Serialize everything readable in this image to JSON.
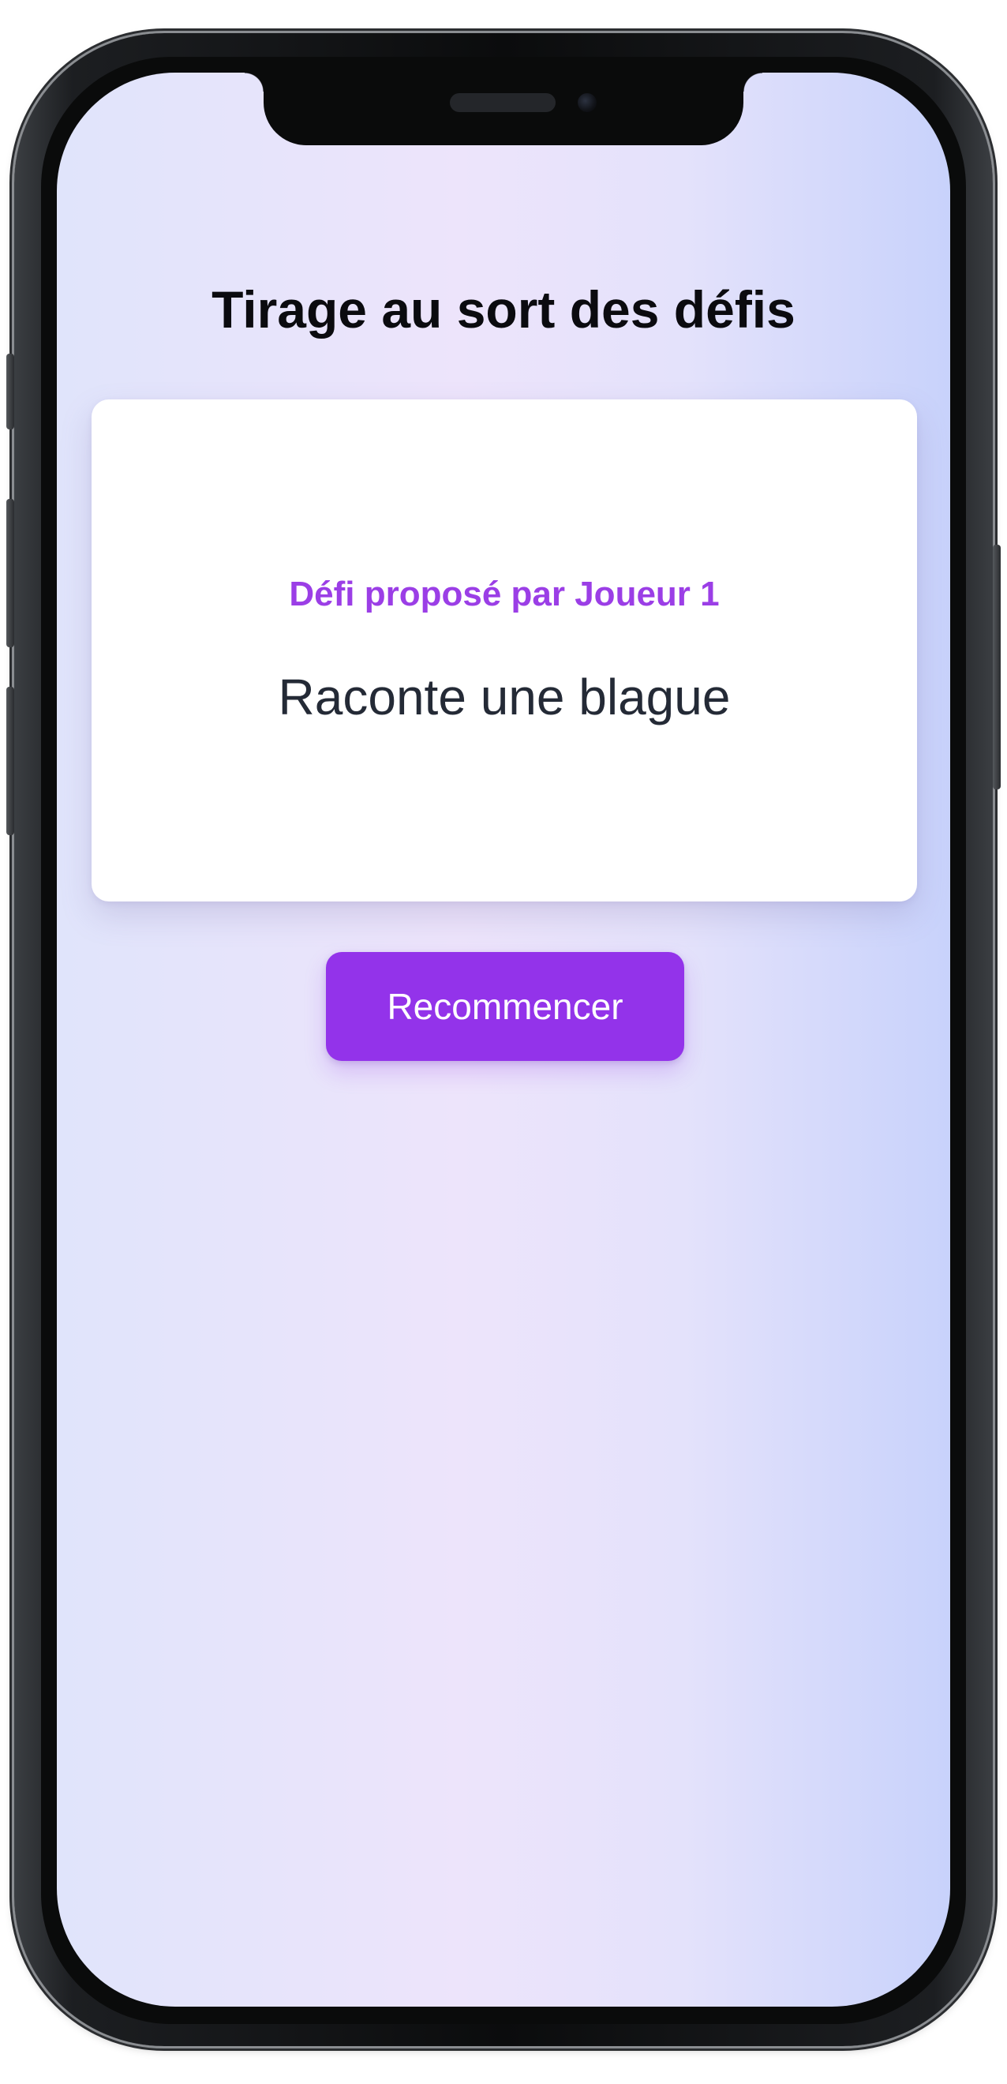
{
  "app": {
    "title": "Tirage au sort des défis"
  },
  "card": {
    "proposer_label": "Défi proposé par Joueur 1",
    "challenge_text": "Raconte une blague"
  },
  "actions": {
    "restart_label": "Recommencer"
  },
  "colors": {
    "accent": "#9333ea",
    "proposer_text": "#9b3ee6",
    "challenge_text": "#242a36",
    "background_left": "#e0e4fb",
    "background_right": "#c8d2fb"
  }
}
